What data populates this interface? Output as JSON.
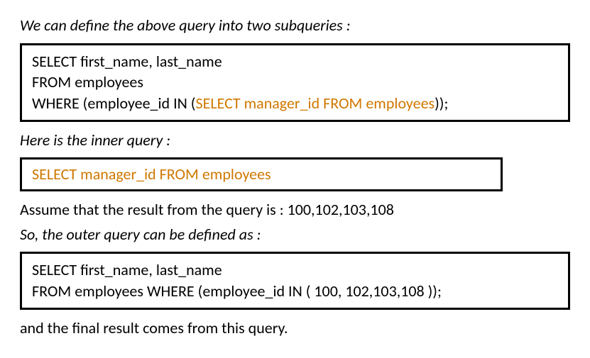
{
  "lines": {
    "intro": "We can define the above query into two subqueries :",
    "inner_query_label": "Here is the inner query :",
    "assume_line": "Assume that the result from the query is : 100,102,103,108",
    "outer_label": "So, the outer query can be defined as :",
    "final_line": "and the final result comes from this query."
  },
  "code_box1": {
    "l1": "SELECT first_name, last_name",
    "l2": "FROM employees",
    "l3a": "WHERE (employee_id IN (",
    "l3b": "SELECT manager_id FROM employees",
    "l3c": "));"
  },
  "code_box2": {
    "l1": "SELECT manager_id FROM employees"
  },
  "code_box3": {
    "l1": "SELECT first_name, last_name",
    "l2": "FROM employees WHERE (employee_id IN ( 100, 102,103,108 ));"
  },
  "chart_data": {
    "type": "table",
    "title": "SQL subquery decomposition example",
    "inner_query_result": [
      100,
      102,
      103,
      108
    ],
    "outer_query_columns": [
      "first_name",
      "last_name"
    ],
    "table": "employees",
    "filter_column": "employee_id"
  }
}
